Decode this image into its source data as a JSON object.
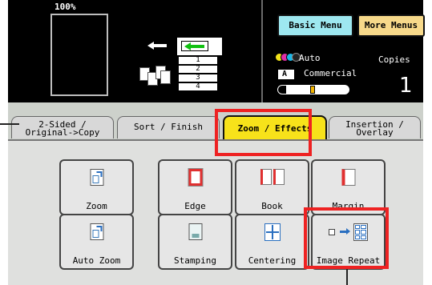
{
  "status": {
    "zoom_percent": "100%",
    "trays": [
      "1",
      "2",
      "3",
      "4"
    ],
    "sheet_numbers": [
      "2",
      "1"
    ],
    "color_mode": "Auto",
    "original_type": "Commercial",
    "copies_label": "Copies",
    "copies_count": "1"
  },
  "menus": {
    "basic": "Basic Menu",
    "more": "More Menus"
  },
  "tabs": [
    {
      "label": "2-Sided /\nOriginal->Copy",
      "selected": false
    },
    {
      "label": "Sort / Finish",
      "selected": false
    },
    {
      "label": "Zoom / Effects",
      "selected": true
    },
    {
      "label": "Insertion /\nOverlay",
      "selected": false
    }
  ],
  "functions": [
    {
      "label": "Zoom",
      "icon": "zoom-icon"
    },
    {
      "label": "Edge",
      "icon": "edge-icon"
    },
    {
      "label": "Book",
      "icon": "book-icon"
    },
    {
      "label": "Margin",
      "icon": "margin-icon"
    },
    {
      "label": "Auto Zoom",
      "icon": "auto-zoom-icon"
    },
    {
      "label": "Stamping",
      "icon": "stamping-icon"
    },
    {
      "label": "Centering",
      "icon": "centering-icon"
    },
    {
      "label": "Image Repeat",
      "icon": "image-repeat-icon"
    }
  ],
  "colors": {
    "selected_tab": "#f7e21a",
    "basic_menu": "#9ee8f0",
    "more_menus": "#f7d98a",
    "highlight": "#ee2222"
  }
}
